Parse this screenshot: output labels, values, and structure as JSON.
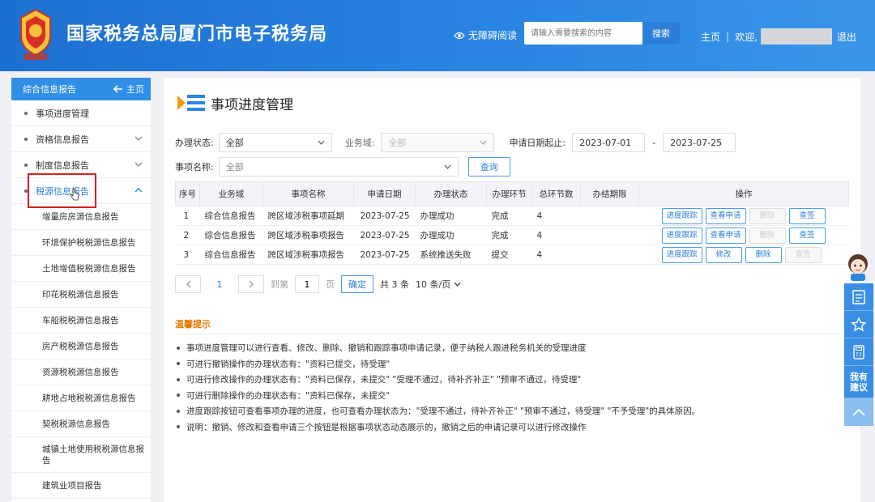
{
  "header": {
    "site_title": "国家税务总局厦门市电子税务局",
    "accessibility": "无障碍阅读",
    "search_placeholder": "请输入需要搜索的内容",
    "search_button": "搜索",
    "home": "主页",
    "welcome": "欢迎,",
    "logout": "退出"
  },
  "sidebar": {
    "head_title": "综合信息报告",
    "home_link": "主页",
    "items": [
      {
        "label": "事项进度管理"
      },
      {
        "label": "资格信息报告"
      },
      {
        "label": "制度信息报告"
      },
      {
        "label": "税源信息报告"
      }
    ],
    "sub_items": [
      "增量房房源信息报告",
      "环境保护税税源信息报告",
      "土地增值税税源信息报告",
      "印花税税源信息报告",
      "车船税税源信息报告",
      "房产税税源信息报告",
      "资源税税源信息报告",
      "耕地占地税税源信息报告",
      "契税税源信息报告",
      "城镇土地使用税税源信息报告",
      "建筑业项目报告"
    ]
  },
  "main": {
    "page_title": "事项进度管理",
    "filters": {
      "status_label": "办理状态:",
      "status_value": "全部",
      "domain_label": "业务域:",
      "domain_value": "全部",
      "date_label": "申请日期起止:",
      "date_from": "2023-07-01",
      "date_sep": "-",
      "date_to": "2023-07-25",
      "item_label": "事项名称:",
      "item_value": "全部",
      "query_button": "查询"
    },
    "table": {
      "headers": [
        "序号",
        "业务域",
        "事项名称",
        "申请日期",
        "办理状态",
        "办理环节",
        "总环节数",
        "办结期限",
        "操作"
      ],
      "rows": [
        {
          "no": "1",
          "domain": "综合信息报告",
          "name": "跨区域涉税事项延期",
          "date": "2023-07-25",
          "status": "办理成功",
          "stage": "完成",
          "total": "4",
          "deadline": "",
          "ops": [
            "进度跟踪",
            "查看申请",
            "删除",
            "查签"
          ]
        },
        {
          "no": "2",
          "domain": "综合信息报告",
          "name": "跨区域涉税事项报告",
          "date": "2023-07-25",
          "status": "办理成功",
          "stage": "完成",
          "total": "4",
          "deadline": "",
          "ops": [
            "进度跟踪",
            "查看申请",
            "删除",
            "查签"
          ]
        },
        {
          "no": "3",
          "domain": "综合信息报告",
          "name": "跨区域涉税事项报告",
          "date": "2023-07-25",
          "status": "系统推送失败",
          "stage": "提交",
          "total": "4",
          "deadline": "",
          "ops": [
            "进度跟踪",
            "修改",
            "删除",
            "查签"
          ]
        }
      ]
    },
    "pager": {
      "current": "1",
      "goto_label": "到第",
      "goto_value": "1",
      "page_unit": "页",
      "ok": "确定",
      "total": "共 3 条",
      "page_size": "10 条/页"
    },
    "tips": {
      "title": "温馨提示",
      "lines": [
        "事项进度管理可以进行查看、修改、删除、撤销和跟踪事项申请记录，便于纳税人跟进税务机关的受理进度",
        "可进行撤销操作的办理状态有：\"资料已提交，待受理\"",
        "可进行修改操作的办理状态有：\"资料已保存，未提交\" \"受理不通过，待补齐补正\" \"预审不通过，待受理\"",
        "可进行删除操作的办理状态有：\"资料已保存，未提交\"",
        "进度跟踪按钮可查看事项办理的进度，也可查看办理状态为：\"受理不通过，待补齐补正\" \"预审不通过，待受理\" \"不予受理\"的具体原因。",
        "说明：撤销、修改和查看申请三个按钮是根据事项状态动态展示的，撤销之后的申请记录可以进行修改操作"
      ]
    }
  },
  "float_bar": {
    "suggest": "我有建议"
  },
  "colors": {
    "header_blue": "#2b86e3",
    "accent_blue": "#2b7fd8",
    "highlight_red": "#d62020",
    "tips_orange": "#e07b00"
  }
}
